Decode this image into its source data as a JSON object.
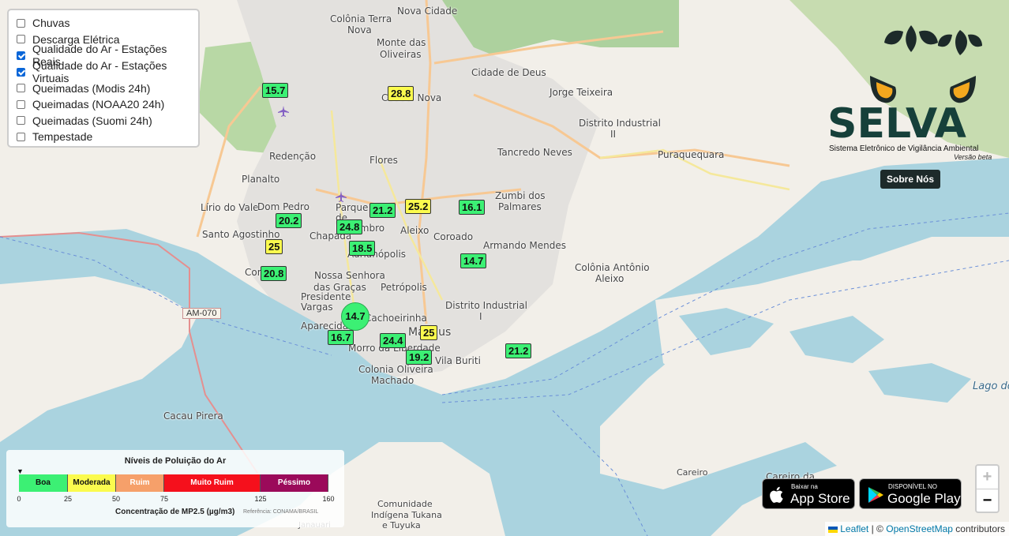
{
  "layers": [
    {
      "label": "Chuvas",
      "checked": false
    },
    {
      "label": "Descarga Elétrica",
      "checked": false
    },
    {
      "label": "Qualidade do Ar - Estações Reais",
      "checked": true
    },
    {
      "label": "Qualidade do Ar - Estações Virtuais",
      "checked": true
    },
    {
      "label": "Queimadas (Modis 24h)",
      "checked": false
    },
    {
      "label": "Queimadas (NOAA20 24h)",
      "checked": false
    },
    {
      "label": "Queimadas (Suomi 24h)",
      "checked": false
    },
    {
      "label": "Tempestade",
      "checked": false
    }
  ],
  "places": [
    {
      "name": "Colônia Terra"
    },
    {
      "name": "Nova"
    },
    {
      "name": "Nova Cidade"
    },
    {
      "name": "Monte das"
    },
    {
      "name": "Oliveiras"
    },
    {
      "name": "Cidade de Deus"
    },
    {
      "name": "Jorge Teixeira"
    },
    {
      "name": "Cidade Nova"
    },
    {
      "name": "Distrito Industrial"
    },
    {
      "name": "II"
    },
    {
      "name": "Tancredo Neves"
    },
    {
      "name": "Puraquequara"
    },
    {
      "name": "Redenção"
    },
    {
      "name": "Flores"
    },
    {
      "name": "Planalto"
    },
    {
      "name": "Zumbi dos"
    },
    {
      "name": "Palmares"
    },
    {
      "name": "Lírio do Vale"
    },
    {
      "name": "Dom Pedro"
    },
    {
      "name": "Parque Dez de Novembro"
    },
    {
      "name": "Aleixo"
    },
    {
      "name": "Santo Agostinho"
    },
    {
      "name": "Chapada"
    },
    {
      "name": "Coroado"
    },
    {
      "name": "Armando Mendes"
    },
    {
      "name": "Adrianópolis"
    },
    {
      "name": "Colônia Antônio"
    },
    {
      "name": "Aleixo"
    },
    {
      "name": "Nossa Senhora"
    },
    {
      "name": "das Graças"
    },
    {
      "name": "Petrópolis"
    },
    {
      "name": "Presidente Vargas"
    },
    {
      "name": "Distrito Industrial"
    },
    {
      "name": "I"
    },
    {
      "name": "Aparecida"
    },
    {
      "name": "Cachoeirinha"
    },
    {
      "name": "Manaus"
    },
    {
      "name": "Morro da Liberdade"
    },
    {
      "name": "Vila Buriti"
    },
    {
      "name": "Colonia Oliveira"
    },
    {
      "name": "Machado"
    },
    {
      "name": "Cacau Pirera"
    },
    {
      "name": "Careiro"
    },
    {
      "name": "Careiro da"
    },
    {
      "name": "Comunidade"
    },
    {
      "name": "Indígena Tukana"
    },
    {
      "name": "e Tuyuka"
    },
    {
      "name": "Janauari"
    },
    {
      "name": "Lago do"
    },
    {
      "name": "Com"
    }
  ],
  "road_label": "AM-070",
  "markers": [
    {
      "value": "15.7",
      "level": "good"
    },
    {
      "value": "28.8",
      "level": "mod"
    },
    {
      "value": "21.2",
      "level": "good"
    },
    {
      "value": "25.2",
      "level": "mod"
    },
    {
      "value": "16.1",
      "level": "good"
    },
    {
      "value": "20.2",
      "level": "good"
    },
    {
      "value": "24.8",
      "level": "good"
    },
    {
      "value": "25",
      "level": "mod"
    },
    {
      "value": "18.5",
      "level": "good"
    },
    {
      "value": "14.7",
      "level": "good"
    },
    {
      "value": "20.8",
      "level": "good"
    },
    {
      "value": "14.7",
      "level": "good"
    },
    {
      "value": "16.7",
      "level": "good"
    },
    {
      "value": "24.4",
      "level": "good"
    },
    {
      "value": "25",
      "level": "mod"
    },
    {
      "value": "19.2",
      "level": "good"
    },
    {
      "value": "21.2",
      "level": "good"
    }
  ],
  "legend": {
    "title": "Níveis de Poluição do Ar",
    "bands": [
      {
        "label": "Boa",
        "from": 0,
        "to": 25,
        "color": "#3cf074",
        "text_color": "#111111"
      },
      {
        "label": "Moderada",
        "from": 25,
        "to": 50,
        "color": "#fbfb4e",
        "text_color": "#111111"
      },
      {
        "label": "Ruim",
        "from": 50,
        "to": 75,
        "color": "#f6a06a",
        "text_color": "#ffffff"
      },
      {
        "label": "Muito Ruim",
        "from": 75,
        "to": 125,
        "color": "#f5101c",
        "text_color": "#ffffff"
      },
      {
        "label": "Péssimo",
        "from": 125,
        "to": 160,
        "color": "#9b0a5a",
        "text_color": "#ffffff"
      }
    ],
    "ticks": [
      "0",
      "25",
      "50",
      "75",
      "125",
      "160"
    ],
    "xlabel": "Concentração de MP2.5 (µg/m3)",
    "reference": "Referência: CONAMA/BRASIL",
    "pointer": "▼"
  },
  "brand": {
    "name": "SELVA",
    "subtitle": "Sistema Eletrônico de Vigilância Ambiental",
    "version": "Versão beta",
    "about_label": "Sobre Nós"
  },
  "stores": {
    "apple_small": "Baixar na",
    "apple_big": "App Store",
    "google_small": "DISPONÍVEL NO",
    "google_big": "Google Play"
  },
  "zoom": {
    "in": "+",
    "out": "−"
  },
  "attribution": {
    "leaflet": "Leaflet",
    "separator": "| ©",
    "osm": "OpenStreetMap",
    "suffix": "contributors"
  },
  "colors": {
    "water": "#aad3df",
    "green_area": "#add19e",
    "urban": "#e0dfdf",
    "land": "#f2efe9"
  }
}
